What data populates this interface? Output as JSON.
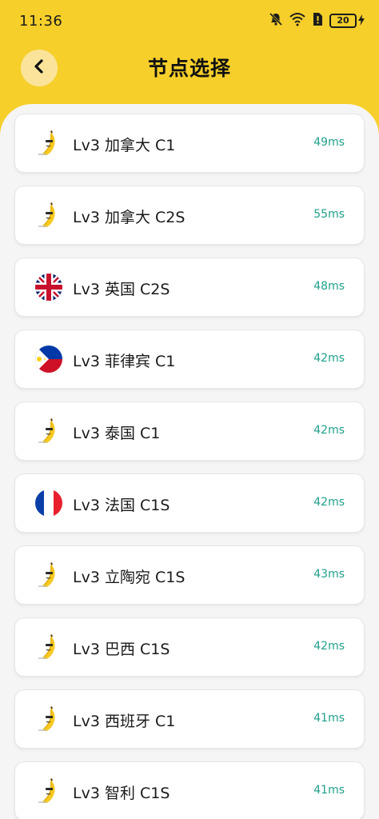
{
  "status": {
    "time": "11:36",
    "battery": "20"
  },
  "header": {
    "title": "节点选择"
  },
  "nodes": [
    {
      "name": "Lv3 加拿大 C1",
      "ping": "49ms",
      "icon": "banana-icon"
    },
    {
      "name": "Lv3 加拿大 C2S",
      "ping": "55ms",
      "icon": "banana-icon"
    },
    {
      "name": "Lv3 英国 C2S",
      "ping": "48ms",
      "icon": "uk-flag-icon"
    },
    {
      "name": "Lv3 菲律宾 C1",
      "ping": "42ms",
      "icon": "philippines-flag-icon"
    },
    {
      "name": "Lv3 泰国 C1",
      "ping": "42ms",
      "icon": "banana-icon"
    },
    {
      "name": "Lv3 法国 C1S",
      "ping": "42ms",
      "icon": "france-flag-icon"
    },
    {
      "name": "Lv3 立陶宛 C1S",
      "ping": "43ms",
      "icon": "banana-icon"
    },
    {
      "name": "Lv3 巴西 C1S",
      "ping": "42ms",
      "icon": "banana-icon"
    },
    {
      "name": "Lv3 西班牙 C1",
      "ping": "41ms",
      "icon": "banana-icon"
    },
    {
      "name": "Lv3 智利 C1S",
      "ping": "41ms",
      "icon": "banana-icon"
    }
  ],
  "colors": {
    "accent": "#f6cf2a",
    "ping": "#1fa08a"
  }
}
